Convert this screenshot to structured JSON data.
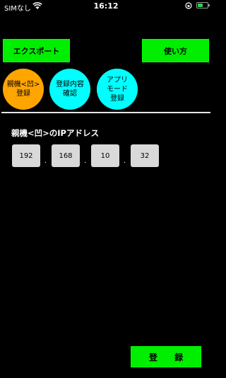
{
  "status_bar": {
    "carrier": "SIMなし",
    "time": "16:12",
    "battery_level": 0.55,
    "battery_color": "#30d158"
  },
  "top_buttons": {
    "export_label": "エクスポート",
    "usage_label": "使い方"
  },
  "circle_buttons": [
    {
      "lines": [
        "親機<凹>",
        "登録"
      ],
      "color": "#ffa500"
    },
    {
      "lines": [
        "登録内容",
        "確認"
      ],
      "color": "#00ffff"
    },
    {
      "lines": [
        "アプリ",
        "モード",
        "登録"
      ],
      "color": "#00ffff"
    }
  ],
  "ip_section": {
    "label": "親機<凹>のIPアドレス",
    "octets": [
      "192",
      "168",
      "10",
      "32"
    ],
    "separator": "."
  },
  "register_button": {
    "label": "登 録"
  },
  "colors": {
    "accent_green": "#00ee00",
    "background": "#000000",
    "input_bg": "#d9d9d9"
  }
}
